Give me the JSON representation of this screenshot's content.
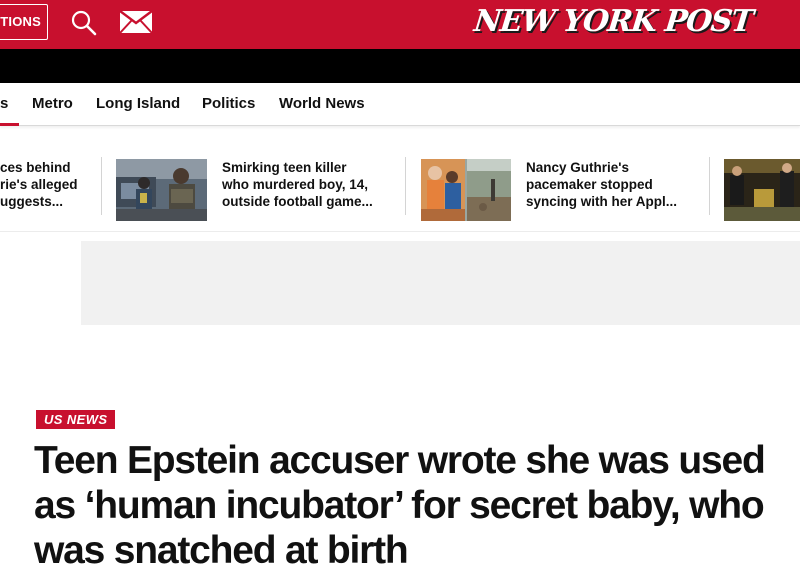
{
  "header": {
    "editions_label": "TIONS",
    "logo_text": "NEW YORK POST",
    "brand_red": "#c8102e",
    "search_icon": "search-icon",
    "mail_icon": "mail-icon"
  },
  "nav": {
    "items": [
      {
        "label": "s"
      },
      {
        "label": "Metro"
      },
      {
        "label": "Long Island"
      },
      {
        "label": "Politics"
      },
      {
        "label": "World News"
      }
    ]
  },
  "trending": [
    {
      "lines": [
        "ces behind",
        "rie's alleged",
        "uggests..."
      ]
    },
    {
      "lines": [
        "Smirking teen killer",
        "who murdered boy, 14,",
        "outside football game..."
      ]
    },
    {
      "lines": [
        "Nancy Guthrie's",
        "pacemaker stopped",
        "syncing with her Appl..."
      ]
    }
  ],
  "article": {
    "section": "US NEWS",
    "headline": "Teen Epstein accuser wrote she was used as ‘human incubator’ for secret baby, who was snatched at birth"
  }
}
